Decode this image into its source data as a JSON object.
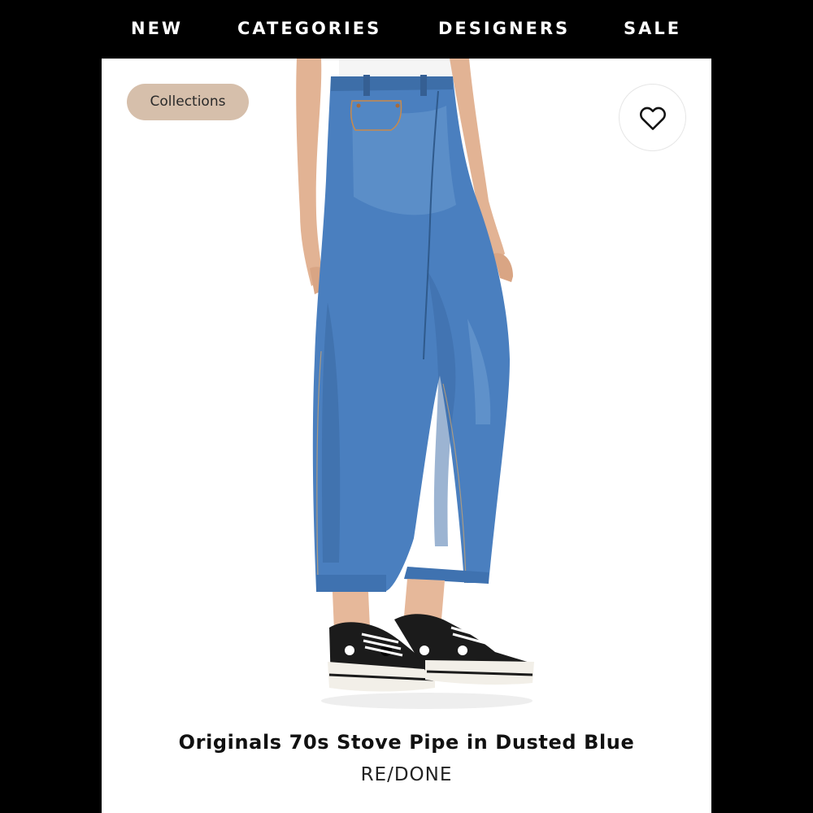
{
  "nav": {
    "items": [
      {
        "label": "NEW"
      },
      {
        "label": "CATEGORIES"
      },
      {
        "label": "DESIGNERS"
      },
      {
        "label": "SALE"
      }
    ]
  },
  "badge": {
    "label": "Collections"
  },
  "favorite": {
    "icon": "heart-outline-icon"
  },
  "product": {
    "title": "Originals 70s Stove Pipe in Dusted Blue",
    "brand": "RE/DONE"
  },
  "colors": {
    "nav_background": "#000000",
    "card_background": "#ffffff",
    "badge_background": "#d6bfab",
    "denim": "#4a7fbf",
    "shoe": "#1b1b1b"
  }
}
